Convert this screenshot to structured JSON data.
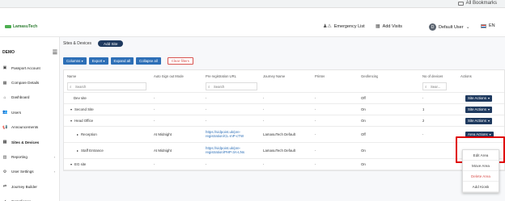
{
  "browser": {
    "bookmarks_label": "All Bookmarks"
  },
  "brand": {
    "logo_text": "LamasuTech"
  },
  "header": {
    "emergency": "Emergency List",
    "add_visits": "Add Visits",
    "user_initial": "D",
    "user_name": "Default User",
    "language": "EN"
  },
  "sidebar": {
    "org": "DEMO",
    "items": [
      {
        "label": "Passport Account",
        "icon": "id-card-icon",
        "glyph": "▣"
      },
      {
        "label": "Compare Details",
        "icon": "grid-icon",
        "glyph": "▦"
      },
      {
        "label": "Dashboard",
        "icon": "home-icon",
        "glyph": "⌂"
      },
      {
        "label": "Users",
        "icon": "users-icon",
        "glyph": "👥"
      },
      {
        "label": "Announcements",
        "icon": "megaphone-icon",
        "glyph": "📢"
      },
      {
        "label": "Sites & Devices",
        "icon": "sites-icon",
        "glyph": "▤"
      },
      {
        "label": "Reporting",
        "icon": "chart-icon",
        "glyph": "▥"
      },
      {
        "label": "User Settings",
        "icon": "user-settings-icon",
        "glyph": "⚙"
      },
      {
        "label": "Journey Builder",
        "icon": "journey-icon",
        "glyph": "⇄"
      },
      {
        "label": "Compliance",
        "icon": "compliance-icon",
        "glyph": "✔"
      }
    ]
  },
  "page": {
    "breadcrumb": "Sites & Devices",
    "add_site": "Add Site"
  },
  "toolbar": {
    "columns": "Columns",
    "export": "Export",
    "expand": "Expand all",
    "collapse": "Collapse all",
    "clear": "Clear filters"
  },
  "table": {
    "headers": [
      "Name",
      "Auto Sign out Mode",
      "Pre registration URL",
      "Journey Name",
      "Printer",
      "Geofencing",
      "No of devices",
      "Actions"
    ],
    "search_placeholder": "Search",
    "search_short": "Sear...",
    "rows": [
      {
        "name": "Dev site",
        "mode": "-",
        "url": "-",
        "journey": "-",
        "printer": "-",
        "geo": "Off",
        "devices": "-",
        "action": "Site Actions"
      },
      {
        "name": "Second Site",
        "mode": "-",
        "url": "-",
        "journey": "-",
        "printer": "-",
        "geo": "On",
        "devices": "1",
        "action": "Site Actions"
      },
      {
        "name": "Head Office",
        "mode": "-",
        "url": "-",
        "journey": "-",
        "printer": "-",
        "geo": "On",
        "devices": "2",
        "action": "Site Actions"
      },
      {
        "name": "Reception",
        "mode": "At Midnight",
        "url": "https://vidpoint.uk/pre-registration/CL-mP-cTW",
        "journey": "LamasuTech Default",
        "printer": "-",
        "geo": "Off",
        "devices": "-",
        "action": "Area Actions"
      },
      {
        "name": "Staff Entrance",
        "mode": "At Midnight",
        "url": "https://vidpoint.uk/pre-registration/PHP-3A-LNs",
        "journey": "LamasuTech Default",
        "printer": "-",
        "geo": "On",
        "devices": "",
        "action": ""
      },
      {
        "name": "EG site",
        "mode": "-",
        "url": "-",
        "journey": "-",
        "printer": "-",
        "geo": "On",
        "devices": "",
        "action": ""
      }
    ]
  },
  "dropdown": {
    "items": [
      "Edit Area",
      "Move Area",
      "Delete Area",
      "Add Kiosk"
    ]
  }
}
